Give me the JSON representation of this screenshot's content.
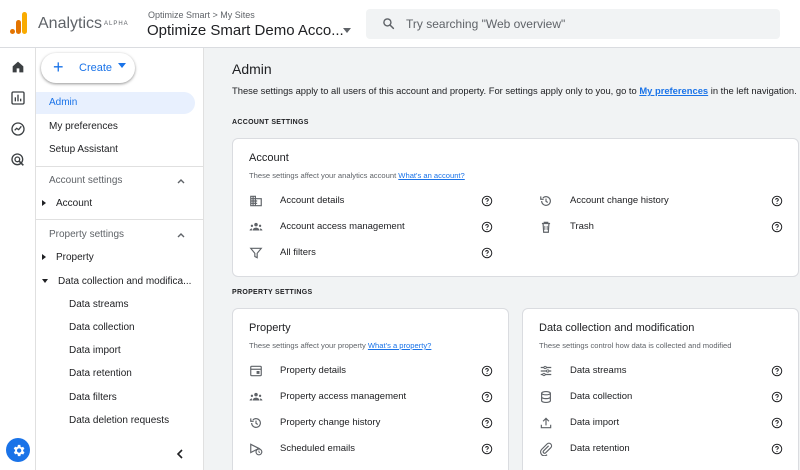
{
  "header": {
    "app_name": "Analytics",
    "badge": "ALPHA",
    "breadcrumb": "Optimize Smart > My Sites",
    "account_name": "Optimize Smart Demo Acco...",
    "search_placeholder": "Try searching \"Web overview\""
  },
  "sidebar": {
    "create_label": "Create",
    "items": {
      "admin": "Admin",
      "my_preferences": "My preferences",
      "setup_assistant": "Setup Assistant"
    },
    "account_settings": {
      "heading": "Account settings",
      "account": "Account"
    },
    "property_settings": {
      "heading": "Property settings",
      "property": "Property",
      "data_collection": "Data collection and modifica...",
      "children": [
        "Data streams",
        "Data collection",
        "Data import",
        "Data retention",
        "Data filters",
        "Data deletion requests"
      ]
    }
  },
  "main": {
    "title": "Admin",
    "desc_before": "These settings apply to all users of this account and property. For settings apply only to you, go to ",
    "desc_link": "My preferences",
    "desc_after": " in the left navigation.",
    "account_settings_label": "ACCOUNT SETTINGS",
    "property_settings_label": "PROPERTY SETTINGS",
    "account_card": {
      "title": "Account",
      "subtitle": "These settings affect your analytics account ",
      "subtitle_link": "What's an account?",
      "left": [
        "Account details",
        "Account access management",
        "All filters"
      ],
      "right": [
        "Account change history",
        "Trash"
      ]
    },
    "property_card": {
      "title": "Property",
      "subtitle": "These settings affect your property ",
      "subtitle_link": "What's a property?",
      "items": [
        "Property details",
        "Property access management",
        "Property change history",
        "Scheduled emails"
      ]
    },
    "data_card": {
      "title": "Data collection and modification",
      "subtitle": "These settings control how data is collected and modified",
      "items": [
        "Data streams",
        "Data collection",
        "Data import",
        "Data retention"
      ]
    }
  },
  "colors": {
    "accent": "#1a73e8",
    "logo_orange": "#f9ab00",
    "logo_dark_orange": "#e37400"
  }
}
